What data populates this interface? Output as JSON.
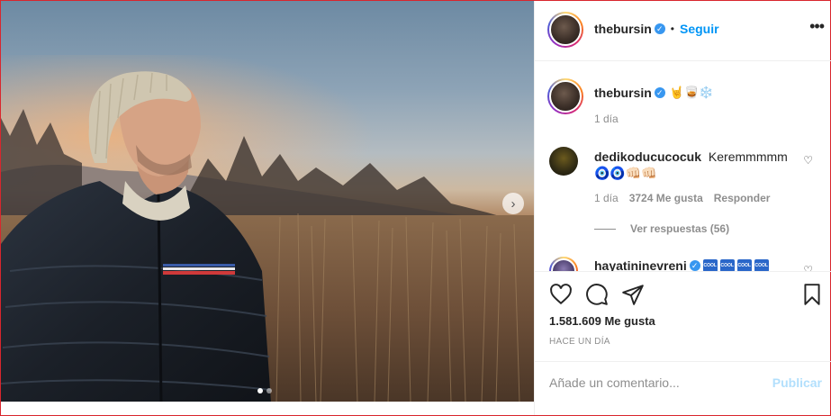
{
  "post": {
    "author": "thebursin",
    "follow_label": "Seguir",
    "separator": "•",
    "more_glyph": "•••",
    "next_glyph": "›",
    "slides": 2,
    "active_slide": 1
  },
  "caption": {
    "username": "thebursin",
    "emojis": "🤘🥃❄️",
    "time": "1 día"
  },
  "comments": [
    {
      "username": "dedikoducucocuk",
      "text": "Keremmmmm",
      "emojis": "🧿🧿👊🏻👊🏻",
      "time": "1 día",
      "likes": "3724 Me gusta",
      "reply_label": "Responder",
      "view_replies": "Ver respuestas (56)"
    },
    {
      "username": "hayatininevreni",
      "badges": [
        "COOL",
        "COOL",
        "COOL",
        "COOL"
      ]
    }
  ],
  "actions": {
    "likes_count": "1.581.609 Me gusta",
    "time_ago": "HACE UN DÍA"
  },
  "add_comment": {
    "placeholder": "Añade un comentario...",
    "publish_label": "Publicar"
  },
  "colors": {
    "link_blue": "#0095f6",
    "verified_blue": "#3897f0",
    "publish_disabled": "#b2dffc",
    "muted_text": "#8e8e8e",
    "frame_red": "#d9262d"
  }
}
